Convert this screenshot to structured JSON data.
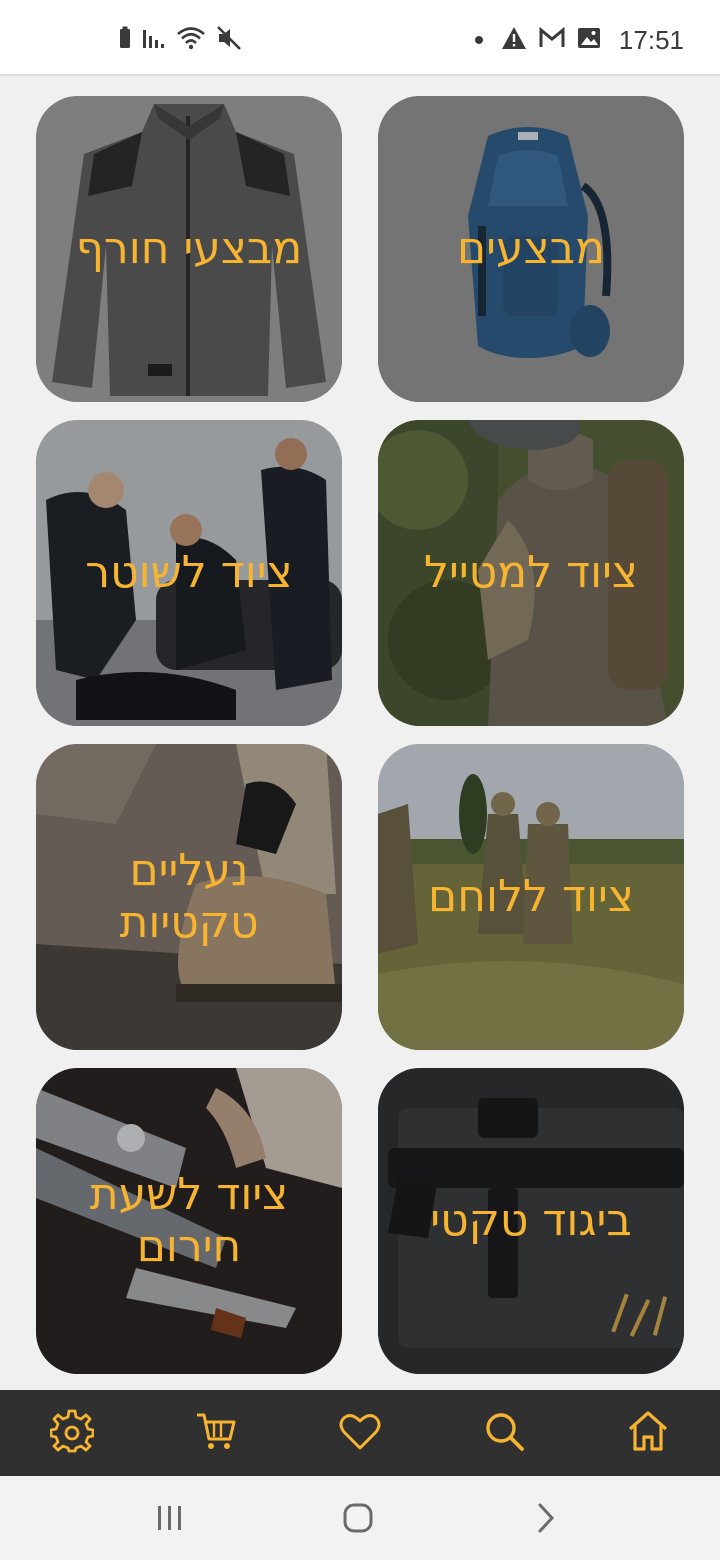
{
  "status_bar": {
    "time": "17:51",
    "left_icons": [
      "battery-icon",
      "signal-icon",
      "wifi-icon",
      "mute-icon"
    ],
    "right_icons": [
      "notification-dot-icon",
      "warning-icon",
      "gmail-icon",
      "image-icon"
    ]
  },
  "categories": [
    {
      "label": "מבצעים",
      "scene": "backpack"
    },
    {
      "label": "מבצעי חורף",
      "scene": "jacket"
    },
    {
      "label": "ציוד למטייל",
      "scene": "hiker"
    },
    {
      "label": "ציוד לשוטר",
      "scene": "police"
    },
    {
      "label": "ציוד ללוחם",
      "scene": "soldiers"
    },
    {
      "label": "נעליים\nטקטיות",
      "scene": "boots"
    },
    {
      "label": "ביגוד טקטי",
      "scene": "rifle"
    },
    {
      "label": "ציוד לשעת\nחירום",
      "scene": "multitool"
    }
  ],
  "tab_bar": {
    "accent": "#f7b430",
    "background": "#303030",
    "tabs": [
      "home-icon",
      "search-icon",
      "heart-icon",
      "cart-icon",
      "settings-icon"
    ]
  },
  "nav_bar": {
    "buttons": [
      "recent-apps-icon",
      "home-circle-icon",
      "back-icon"
    ]
  }
}
